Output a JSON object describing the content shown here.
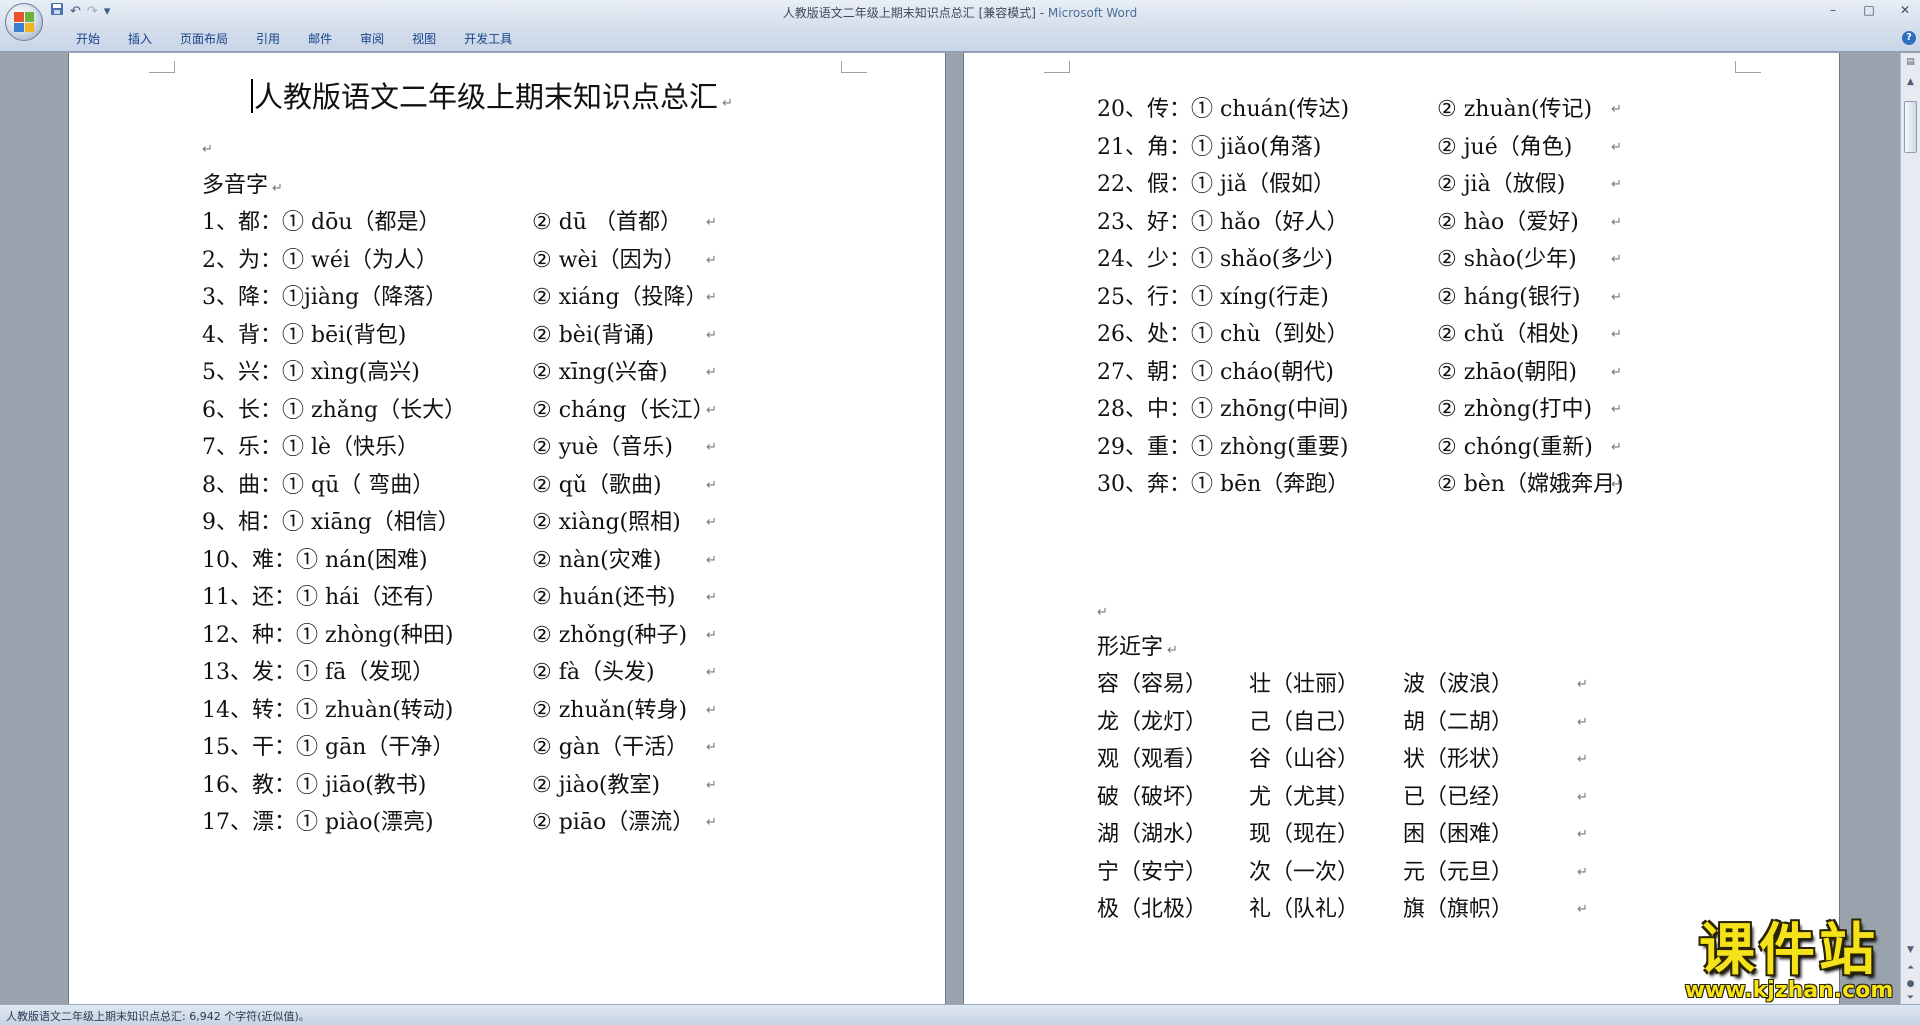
{
  "window": {
    "title": "人教版语文二年级上期末知识点总汇 [兼容模式] - ",
    "app_name": "Microsoft Word",
    "controls": {
      "minimize": "–",
      "maximize": "□",
      "close": "✕"
    }
  },
  "quick_access": {
    "save_icon": "save-icon",
    "undo_icon": "undo-icon",
    "redo_icon": "redo-icon",
    "customize": "▾"
  },
  "ribbon": {
    "tabs": [
      "开始",
      "插入",
      "页面布局",
      "引用",
      "邮件",
      "审阅",
      "视图",
      "开发工具"
    ],
    "help": "?"
  },
  "document": {
    "title": "人教版语文二年级上期末知识点总汇",
    "para_mark": "↵",
    "sections": {
      "polyphonic_heading": "多音字",
      "similar_heading": "形近字"
    },
    "polyphonic_left": [
      [
        "1、都：① dōu（都是）",
        "② dū （首都）"
      ],
      [
        "2、为：① wéi（为人）",
        "② wèi（因为）"
      ],
      [
        "3、降：①jiàng（降落）",
        "② xiáng（投降）"
      ],
      [
        "4、背：① bēi(背包)",
        "② bèi(背诵)"
      ],
      [
        "5、兴：① xìng(高兴)",
        "② xīng(兴奋)"
      ],
      [
        "6、长：① zhǎng（长大）",
        "② cháng（长江）"
      ],
      [
        "7、乐：① lè（快乐）",
        "② yuè（音乐)"
      ],
      [
        "8、曲：① qū（ 弯曲）",
        "② qǔ（歌曲)"
      ],
      [
        "9、相：① xiāng（相信）",
        "② xiàng(照相)"
      ],
      [
        "10、难：① nán(困难)",
        "② nàn(灾难)"
      ],
      [
        "11、还：① hái（还有）",
        "② huán(还书)"
      ],
      [
        "12、种：① zhòng(种田)",
        "② zhǒng(种子)"
      ],
      [
        "13、发：① fā（发现）",
        "② fà（头发)"
      ],
      [
        "14、转：① zhuàn(转动)",
        "② zhuǎn(转身)"
      ],
      [
        "15、干：① gān（干净）",
        "② gàn（干活）"
      ],
      [
        "16、教：① jiāo(教书)",
        "② jiào(教室)"
      ],
      [
        "17、漂：① piào(漂亮)",
        "② piāo（漂流）"
      ]
    ],
    "polyphonic_right": [
      [
        "20、传：① chuán(传达)",
        "② zhuàn(传记)"
      ],
      [
        "21、角：① jiǎo(角落)",
        "② jué（角色)"
      ],
      [
        "22、假：① jiǎ（假如）",
        "② jià（放假)"
      ],
      [
        "23、好：① hǎo（好人）",
        "② hào（爱好)"
      ],
      [
        "24、少：① shǎo(多少)",
        "② shào(少年)"
      ],
      [
        "25、行：① xíng(行走)",
        "② háng(银行)"
      ],
      [
        "26、处：① chù（到处）",
        "② chǔ（相处)"
      ],
      [
        "27、朝：① cháo(朝代)",
        "② zhāo(朝阳)"
      ],
      [
        "28、中：① zhōng(中间)",
        "② zhòng(打中)"
      ],
      [
        "29、重：① zhòng(重要)",
        "② chóng(重新)"
      ],
      [
        "30、奔：① bēn（奔跑）",
        "② bèn（嫦娥奔月)"
      ]
    ],
    "similar_words": [
      [
        "容（容易）",
        "壮（壮丽）",
        "波（波浪）"
      ],
      [
        "龙（龙灯）",
        "己（自己）",
        "胡（二胡）"
      ],
      [
        "观（观看）",
        "谷（山谷）",
        "状（形状）"
      ],
      [
        "破（破坏）",
        "尤（尤其）",
        "已（已经）"
      ],
      [
        "湖（湖水）",
        "现（现在）",
        "困（困难）"
      ],
      [
        "宁（安宁）",
        "次（一次）",
        "元（元旦）"
      ],
      [
        "极（北极）",
        "礼（队礼）",
        "旗（旗帜）"
      ]
    ]
  },
  "statusbar": {
    "text": "人教版语文二年级上期末知识点总汇: 6,942 个字符(近似值)。"
  },
  "watermark": {
    "text": "课件站",
    "url": "www.kjzhan.com"
  },
  "colors": {
    "page": "#ffffff",
    "workspace": "#9aa3ad",
    "ribbon_text": "#15428b",
    "watermark": "#f6e21a"
  }
}
